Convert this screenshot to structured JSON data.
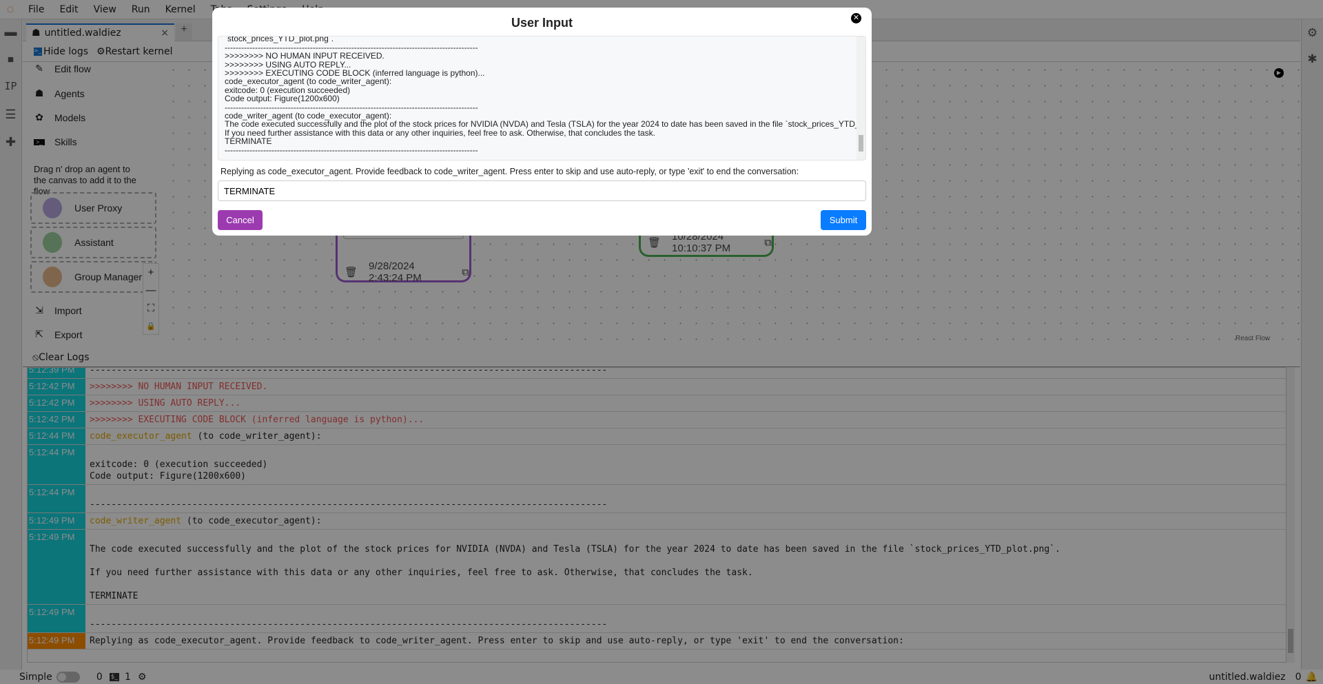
{
  "menu": [
    "File",
    "Edit",
    "View",
    "Run",
    "Kernel",
    "Tabs",
    "Settings",
    "Help"
  ],
  "tab": {
    "title": "untitled.waldiez",
    "close": "×",
    "add": "+"
  },
  "toolbar": {
    "hide_logs": "Hide logs",
    "restart_kernel": "Restart kernel"
  },
  "left_icons": [
    "folder-icon",
    "running-icon",
    "IP",
    "list-icon",
    "extension-icon"
  ],
  "left_ip": "IP",
  "sidebar": {
    "edit_flow": "Edit flow",
    "agents": "Agents",
    "models": "Models",
    "skills": "Skills",
    "drag_hint": "Drag n' drop an agent to the canvas to add it to the flow",
    "agent_types": [
      "User Proxy",
      "Assistant",
      "Group Manager"
    ],
    "import": "Import",
    "export": "Export"
  },
  "canvas": {
    "node1_date": "9/28/2024 2:43:24 PM",
    "node2_date": "10/28/2024 10:10:37 PM",
    "attribution": "React Flow",
    "zoom_controls": [
      "+",
      "—",
      "⛶",
      "🔒"
    ]
  },
  "logs": {
    "clear": "Clear Logs",
    "rows": [
      {
        "time": "5:12:39 PM",
        "text": "------------------------------------------------------------------------------------------------"
      },
      {
        "time": "5:12:42 PM",
        "text": ">>>>>>>> NO HUMAN INPUT RECEIVED.",
        "style": "red"
      },
      {
        "time": "5:12:42 PM",
        "text": ">>>>>>>> USING AUTO REPLY...",
        "style": "red"
      },
      {
        "time": "5:12:42 PM",
        "text": ">>>>>>>> EXECUTING CODE BLOCK (inferred language is python)...",
        "style": "red"
      },
      {
        "time": "5:12:44 PM",
        "agent": "code_executor_agent",
        "text": " (to code_writer_agent):"
      },
      {
        "time": "5:12:44 PM",
        "text": "\nexitcode: 0 (execution succeeded)\nCode output: Figure(1200x600)"
      },
      {
        "time": "5:12:44 PM",
        "text": "\n------------------------------------------------------------------------------------------------"
      },
      {
        "time": "5:12:49 PM",
        "agent": "code_writer_agent",
        "text": " (to code_executor_agent):"
      },
      {
        "time": "5:12:49 PM",
        "text": "\nThe code executed successfully and the plot of the stock prices for NVIDIA (NVDA) and Tesla (TSLA) for the year 2024 to date has been saved in the file `stock_prices_YTD_plot.png`.\n\nIf you need further assistance with this data or any other inquiries, feel free to ask. Otherwise, that concludes the task.\n\nTERMINATE"
      },
      {
        "time": "5:12:49 PM",
        "text": "\n------------------------------------------------------------------------------------------------"
      },
      {
        "time": "5:12:49 PM",
        "text": "Replying as code_executor_agent. Provide feedback to code_writer_agent. Press enter to skip and use auto-reply, or type 'exit' to end the conversation:",
        "style": "orange"
      }
    ]
  },
  "status": {
    "mode": "Simple",
    "count1": "0",
    "terminals": "1",
    "file": "untitled.waldiez",
    "notifications": "0"
  },
  "modal": {
    "title": "User Input",
    "log": "`stock_prices_YTD_plot.png`.\n--------------------------------------------------------------------------------------------\n>>>>>>>> NO HUMAN INPUT RECEIVED.\n>>>>>>>> USING AUTO REPLY...\n>>>>>>>> EXECUTING CODE BLOCK (inferred language is python)...\ncode_executor_agent (to code_writer_agent):\nexitcode: 0 (execution succeeded)\nCode output: Figure(1200x600)\n--------------------------------------------------------------------------------------------\ncode_writer_agent (to code_executor_agent):\nThe code executed successfully and the plot of the stock prices for NVIDIA (NVDA) and Tesla (TSLA) for the year 2024 to date has been saved in the file `stock_prices_YTD_plot.png`.\nIf you need further assistance with this data or any other inquiries, feel free to ask. Otherwise, that concludes the task.\nTERMINATE\n--------------------------------------------------------------------------------------------",
    "prompt": "Replying as code_executor_agent. Provide feedback to code_writer_agent. Press enter to skip and use auto-reply, or type 'exit' to end the conversation:",
    "input_value": "TERMINATE",
    "cancel": "Cancel",
    "submit": "Submit"
  },
  "colors": {
    "cancel": "#9c3bb0",
    "submit": "#0a7cff",
    "timestamp": "#14d6df",
    "timestamp_prompt": "#ff8c00",
    "node1_border": "#9b59d0",
    "node2_border": "#4caf50"
  }
}
